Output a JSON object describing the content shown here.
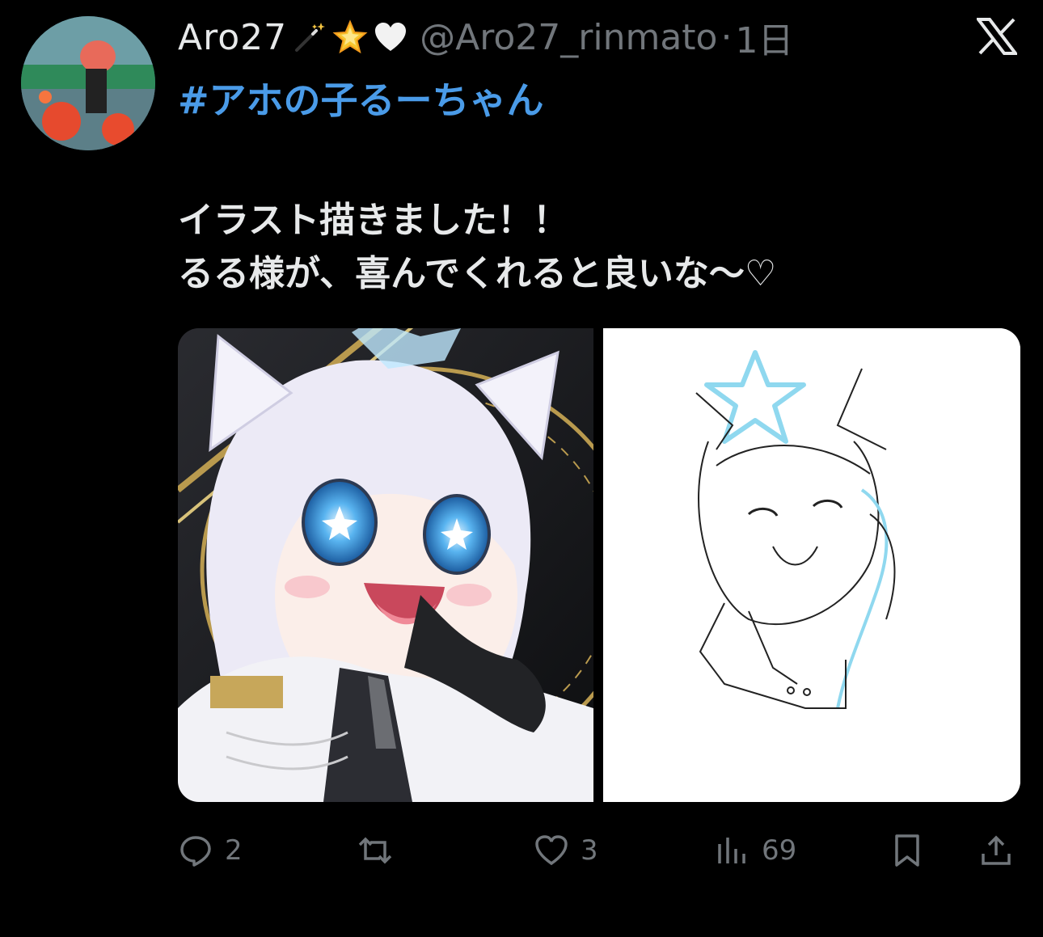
{
  "tweet": {
    "author_name": "Aro27",
    "author_handle": "@Aro27_rinmato",
    "separator": "·",
    "time": "1日",
    "hashtag": "#アホの子るーちゃん",
    "lines": [
      "イラスト描きました！！",
      "るる様が、喜んでくれると良いな〜♡"
    ],
    "name_emojis": [
      "magic-wand-icon",
      "glowing-star-icon",
      "white-heart-icon"
    ]
  },
  "actions": {
    "replies": "2",
    "retweets": "",
    "likes": "3",
    "views": "69"
  },
  "colors": {
    "background": "#000000",
    "hashtag": "#4a9be8",
    "muted": "#71767b",
    "text": "#e7e9ea"
  }
}
